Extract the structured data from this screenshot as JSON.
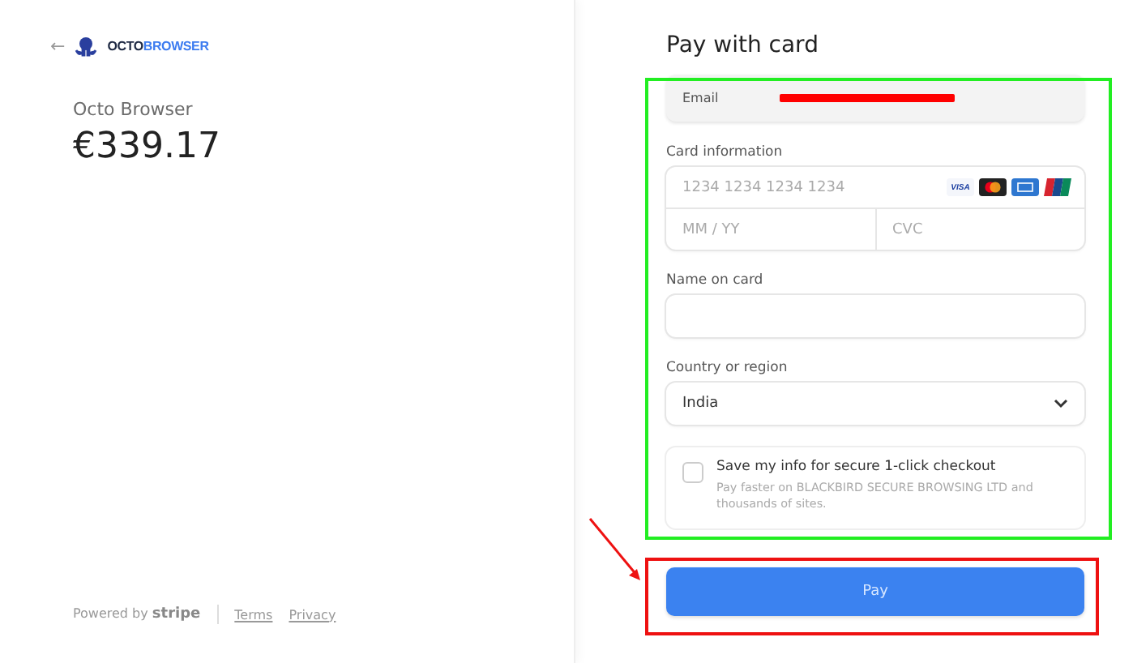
{
  "merchant": {
    "back": "←",
    "logo_1": "OCTO",
    "logo_2": "BROWSER",
    "name": "Octo Browser",
    "price": "€339.17"
  },
  "footer": {
    "powered": "Powered by **stripe**",
    "links": [
      "Terms",
      "Privacy"
    ]
  },
  "form": {
    "title": "Pay with card",
    "email": {
      "label": "Email",
      "redacted": true
    },
    "card": {
      "label": "Card information",
      "number_placeholder": "1234 1234 1234 1234",
      "expiry_placeholder": "MM / YY",
      "cvc_placeholder": "CVC",
      "brands": [
        {
          "kind": "visa",
          "text": "VISA"
        },
        {
          "kind": "mastercard"
        },
        {
          "kind": "amex"
        },
        {
          "kind": "unionpay"
        }
      ]
    },
    "name": {
      "label": "Name on card"
    },
    "country": {
      "label": "Country or region",
      "value": "India"
    },
    "save": {
      "checked": false,
      "label": "Save my info for secure 1-click checkout",
      "note": "Pay faster on BLACKBIRD SECURE BROWSING LTD and thousands of sites."
    },
    "pay_button": "Pay"
  },
  "annotations": [
    {
      "kind": "box",
      "color": "#22ee22"
    },
    {
      "kind": "box",
      "color": "#ee1111"
    },
    {
      "kind": "arrow",
      "color": "#ee1111"
    }
  ]
}
